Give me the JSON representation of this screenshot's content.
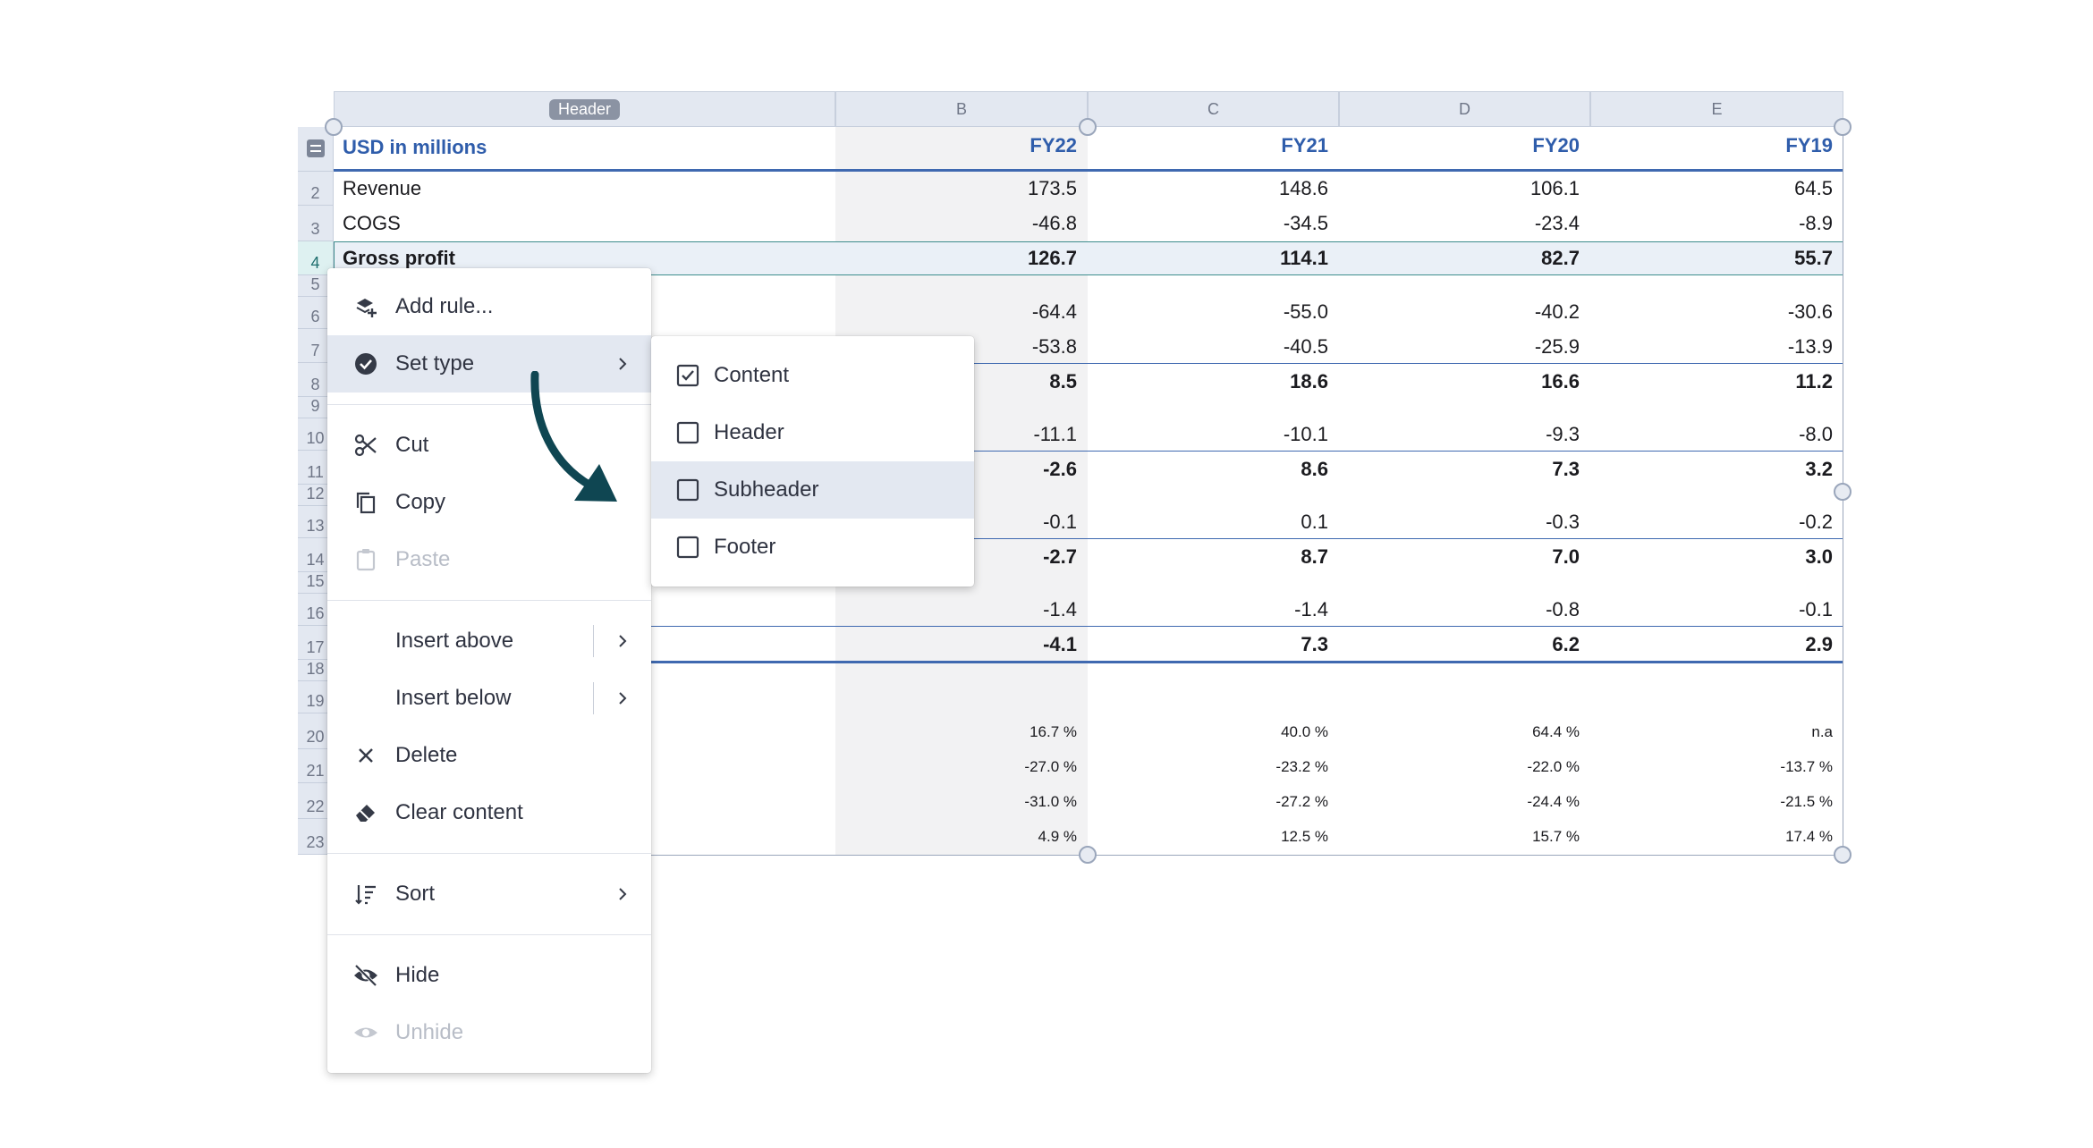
{
  "columns": [
    {
      "letter": "",
      "badge": "Header"
    },
    {
      "letter": "B"
    },
    {
      "letter": "C"
    },
    {
      "letter": "D"
    },
    {
      "letter": "E"
    }
  ],
  "header_row": {
    "label": "USD in millions",
    "values": [
      "FY22",
      "FY21",
      "FY20",
      "FY19"
    ]
  },
  "row_numbers": [
    "2",
    "3",
    "4",
    "5",
    "6",
    "7",
    "8",
    "9",
    "10",
    "11",
    "12",
    "13",
    "14",
    "15",
    "16",
    "17",
    "18",
    "19",
    "20",
    "21",
    "22",
    "23"
  ],
  "rows": [
    {
      "label": "Revenue",
      "values": [
        "173.5",
        "148.6",
        "106.1",
        "64.5"
      ]
    },
    {
      "label": "COGS",
      "values": [
        "-46.8",
        "-34.5",
        "-23.4",
        "-8.9"
      ]
    },
    {
      "label": "Gross profit",
      "values": [
        "126.7",
        "114.1",
        "82.7",
        "55.7"
      ]
    },
    {
      "label": "",
      "values": [
        "-64.4",
        "-55.0",
        "-40.2",
        "-30.6"
      ]
    },
    {
      "label": "",
      "values": [
        "-53.8",
        "-40.5",
        "-25.9",
        "-13.9"
      ]
    },
    {
      "label": "",
      "values": [
        "8.5",
        "18.6",
        "16.6",
        "11.2"
      ]
    },
    {
      "label": "",
      "values": [
        "-11.1",
        "-10.1",
        "-9.3",
        "-8.0"
      ]
    },
    {
      "label": "",
      "values": [
        "-2.6",
        "8.6",
        "7.3",
        "3.2"
      ]
    },
    {
      "label": "",
      "values": [
        "-0.1",
        "0.1",
        "-0.3",
        "-0.2"
      ]
    },
    {
      "label": "",
      "values": [
        "-2.7",
        "8.7",
        "7.0",
        "3.0"
      ]
    },
    {
      "label": "",
      "values": [
        "-1.4",
        "-1.4",
        "-0.8",
        "-0.1"
      ]
    },
    {
      "label": "",
      "values": [
        "-4.1",
        "7.3",
        "6.2",
        "2.9"
      ]
    },
    {
      "label": "",
      "values": [
        "16.7 %",
        "40.0 %",
        "64.4 %",
        "n.a"
      ]
    },
    {
      "label": "",
      "values": [
        "-27.0 %",
        "-23.2 %",
        "-22.0 %",
        "-13.7 %"
      ]
    },
    {
      "label": "",
      "values": [
        "-31.0 %",
        "-27.2 %",
        "-24.4 %",
        "-21.5 %"
      ]
    },
    {
      "label": "",
      "values": [
        "4.9 %",
        "12.5 %",
        "15.7 %",
        "17.4 %"
      ]
    }
  ],
  "context_menu": {
    "items": [
      {
        "label": "Add rule...",
        "icon": "add-rule-icon"
      },
      {
        "label": "Set type",
        "icon": "check-circle-icon"
      },
      {
        "label": "Cut",
        "icon": "scissors-icon"
      },
      {
        "label": "Copy",
        "icon": "copy-icon"
      },
      {
        "label": "Paste",
        "icon": "clipboard-icon"
      },
      {
        "label": "Insert above"
      },
      {
        "label": "Insert below"
      },
      {
        "label": "Delete",
        "icon": "close-icon"
      },
      {
        "label": "Clear content",
        "icon": "eraser-icon"
      },
      {
        "label": "Sort",
        "icon": "sort-icon"
      },
      {
        "label": "Hide",
        "icon": "eye-off-icon"
      },
      {
        "label": "Unhide",
        "icon": "eye-icon"
      }
    ]
  },
  "submenu": {
    "items": [
      {
        "label": "Content",
        "checked": true
      },
      {
        "label": "Header",
        "checked": false
      },
      {
        "label": "Subheader",
        "checked": false
      },
      {
        "label": "Footer",
        "checked": false
      }
    ]
  },
  "colors": {
    "accent": "#3f69b0",
    "selection": "#3d8d8d",
    "arrow": "#0f4652"
  }
}
